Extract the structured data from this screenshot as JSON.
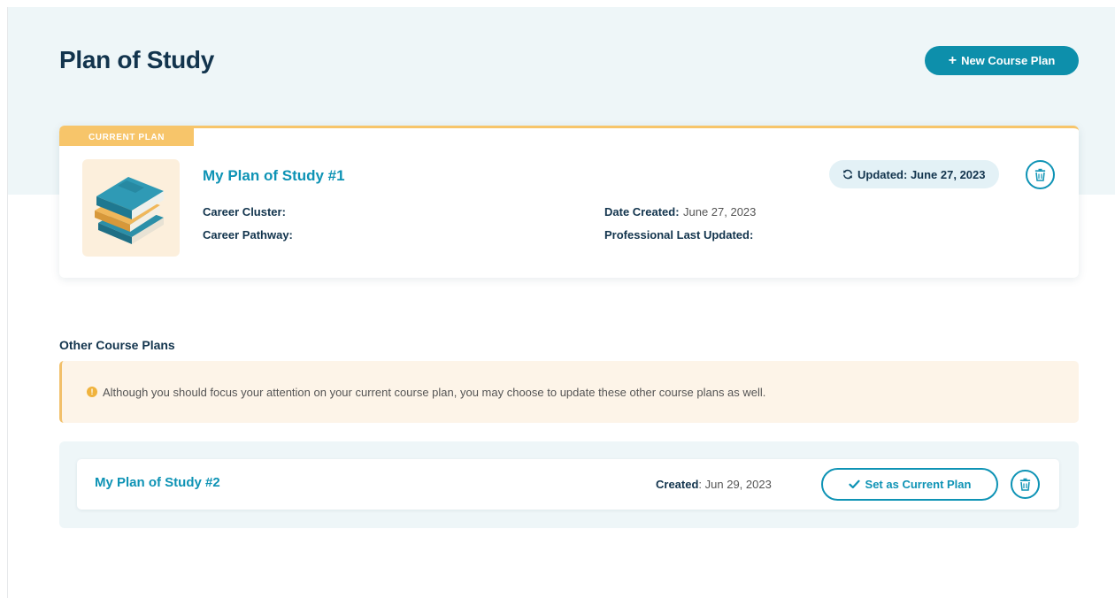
{
  "header": {
    "title": "Plan of Study",
    "new_plan_label": "New Course Plan"
  },
  "current_plan": {
    "tag": "CURRENT PLAN",
    "title": "My Plan of Study #1",
    "updated_label": "Updated: June 27, 2023",
    "career_cluster_label": "Career Cluster:",
    "career_cluster_value": "",
    "career_pathway_label": "Career Pathway:",
    "career_pathway_value": "",
    "date_created_label": "Date Created:",
    "date_created_value": "June 27, 2023",
    "prof_updated_label": "Professional Last Updated:",
    "prof_updated_value": ""
  },
  "other_plans": {
    "heading": "Other Course Plans",
    "alert": "Although you should focus your attention on your current course plan, you may choose to update these other course plans as well.",
    "items": [
      {
        "title": "My Plan of Study #2",
        "created_label": "Created",
        "created_value": ": Jun 29, 2023",
        "set_current_label": "Set as Current Plan"
      }
    ]
  },
  "icons": {
    "plus": "plus-icon",
    "refresh": "refresh-icon",
    "trash": "trash-icon",
    "check": "check-icon",
    "warning": "info-circle-icon",
    "books": "books-illustration"
  },
  "colors": {
    "accent": "#0e93b5",
    "brand_button": "#0d8fab",
    "current_tag": "#f7c56a",
    "title_text": "#12344d",
    "hero_bg": "#eef6f8",
    "alert_bg": "#fdf4e8"
  }
}
